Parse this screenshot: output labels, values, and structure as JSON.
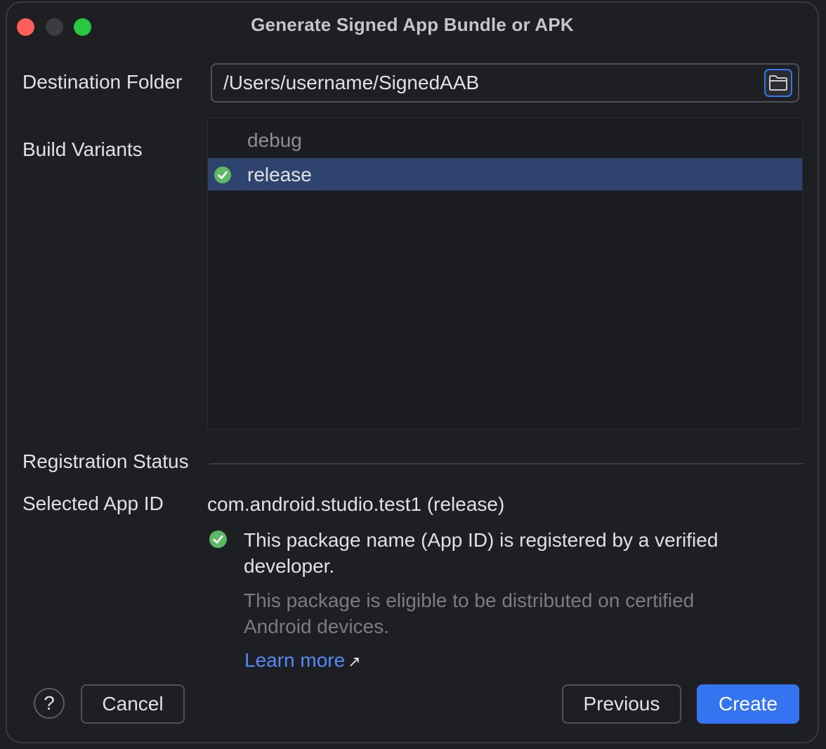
{
  "window": {
    "title": "Generate Signed App Bundle or APK"
  },
  "destination": {
    "label": "Destination Folder",
    "value": "/Users/username/SignedAAB",
    "browse_icon": "folder-icon"
  },
  "build_variants": {
    "label": "Build Variants",
    "items": [
      {
        "label": "debug",
        "selected": false
      },
      {
        "label": "release",
        "selected": true,
        "icon": "check-circle-icon"
      }
    ]
  },
  "registration": {
    "section_label": "Registration Status",
    "app_id_label": "Selected App ID",
    "app_id_value": "com.android.studio.test1 (release)",
    "verified_message": "This package name (App ID) is registered by a verified developer.",
    "eligible_message": "This package is eligible to be distributed on certified Android devices.",
    "learn_more_label": "Learn more",
    "learn_more_arrow": "↗"
  },
  "footer": {
    "help_label": "?",
    "cancel_label": "Cancel",
    "previous_label": "Previous",
    "create_label": "Create"
  },
  "colors": {
    "accent": "#3574f0",
    "selection": "#2e436e",
    "success": "#5fb865",
    "link": "#548af7"
  }
}
